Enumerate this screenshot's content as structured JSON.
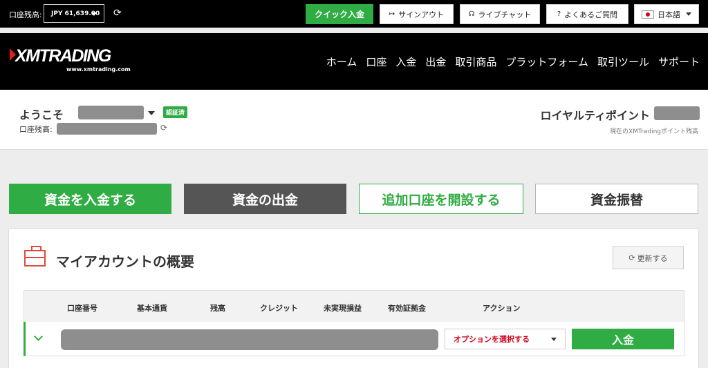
{
  "topbar": {
    "balance_label": "口座残高:",
    "balance_value": "JPY 61,639.00",
    "quick_deposit": "クイック入金",
    "sign_out": "サインアウト",
    "live_chat": "ライブチャット",
    "faq": "よくあるご質問",
    "language": "日本語",
    "icons": {
      "refresh": "refresh-icon",
      "sign_out": "sign-out-icon",
      "headset": "headset-icon",
      "question": "question-circle-icon",
      "flag": "japan-flag-icon"
    }
  },
  "header": {
    "logo_text": "XMTRADING",
    "logo_url": "www.xmtrading.com",
    "nav": [
      "ホーム",
      "口座",
      "入金",
      "出金",
      "取引商品",
      "プラットフォーム",
      "取引ツール",
      "サポート"
    ]
  },
  "welcome": {
    "greeting": "ようこそ",
    "verified_badge": "認証済",
    "balance_label": "口座残高:",
    "loyalty_title": "ロイヤルティポイント",
    "loyalty_sub": "現在のXMTradingポイント残高"
  },
  "actions": {
    "deposit": "資金を入金する",
    "withdraw": "資金の出金",
    "open_account": "追加口座を開設する",
    "transfer": "資金振替"
  },
  "account_panel": {
    "title": "マイアカウントの概要",
    "update_button": "更新する",
    "columns": [
      "口座番号",
      "基本通貨",
      "残高",
      "クレジット",
      "未実現損益",
      "有効証拠金",
      "アクション"
    ],
    "row": {
      "option_select": "オプションを選択する",
      "deposit_button": "入金"
    }
  },
  "colors": {
    "accent_green": "#2fac43",
    "header_black": "#000000",
    "brand_red": "#e31d1a",
    "action_red": "#d0021b"
  }
}
